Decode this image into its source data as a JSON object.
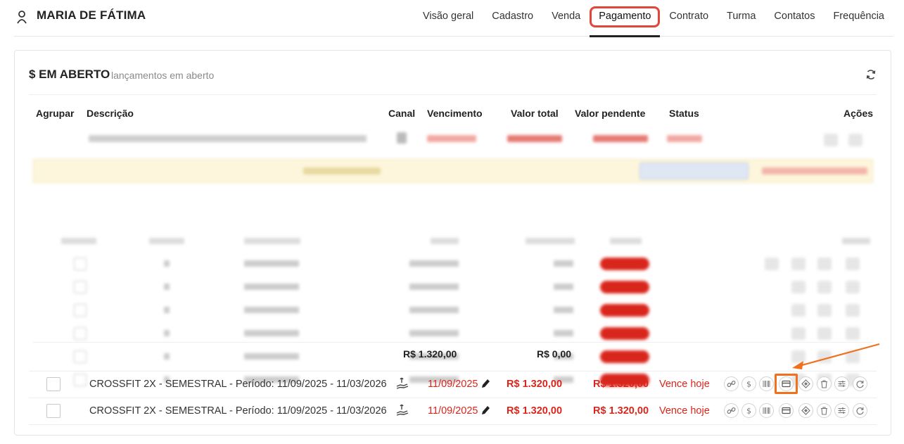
{
  "header": {
    "student_name": "MARIA DE FÁTIMA",
    "tabs": [
      {
        "label": "Visão geral"
      },
      {
        "label": "Cadastro"
      },
      {
        "label": "Venda"
      },
      {
        "label": "Pagamento",
        "active": true
      },
      {
        "label": "Contrato"
      },
      {
        "label": "Turma"
      },
      {
        "label": "Contatos"
      },
      {
        "label": "Frequência"
      }
    ]
  },
  "section": {
    "title": "$ EM ABERTO",
    "subtitle": "lançamentos em aberto"
  },
  "table": {
    "headers": {
      "group": "Agrupar",
      "description": "Descrição",
      "channel": "Canal",
      "due": "Vencimento",
      "total": "Valor total",
      "pending": "Valor pendente",
      "status": "Status",
      "actions": "Ações"
    },
    "subtable_totals": {
      "value": "R$ 1.320,00",
      "paid": "R$ 0,00"
    },
    "rows": [
      {
        "description": "CROSSFIT 2X - SEMESTRAL - Período: 11/09/2025 - 11/03/2026",
        "due": "11/09/2025",
        "total": "R$ 1.320,00",
        "pending": "R$ 1.320,00",
        "status": "Vence hoje"
      },
      {
        "description": "CROSSFIT 2X - SEMESTRAL - Período: 11/09/2025 - 11/03/2026",
        "due": "11/09/2025",
        "total": "R$ 1.320,00",
        "pending": "R$ 1.320,00",
        "status": "Vence hoje"
      }
    ]
  },
  "colors": {
    "danger": "#d9261c",
    "tab_highlight": "#e0463a",
    "annotation_arrow": "#f0701e"
  }
}
